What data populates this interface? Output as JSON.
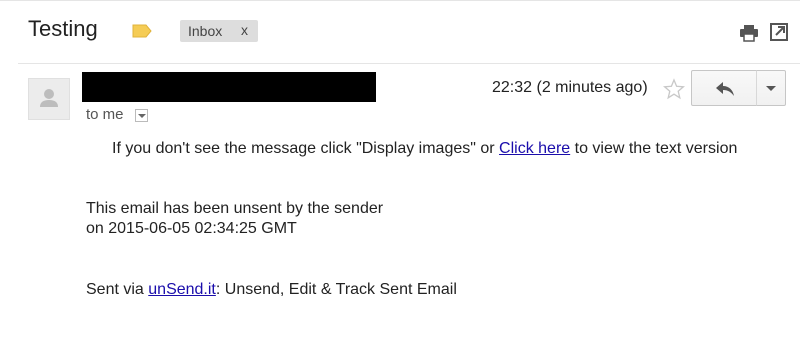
{
  "email": {
    "subject": "Testing",
    "label_chip": {
      "text": "Inbox",
      "close": "x"
    },
    "recipient": "to me",
    "timestamp": "22:32 (2 minutes ago)",
    "body": {
      "notice_before": "If you don't see the message click \"Display images\" or ",
      "notice_link": "Click here",
      "notice_after": " to view the text version",
      "unsent_line1": "This email has been unsent by the sender",
      "unsent_line2": "on 2015-06-05 02:34:25 GMT",
      "sent_via_prefix": "Sent via ",
      "sent_via_link": "unSend.it",
      "sent_via_suffix": ": Unsend, Edit & Track Sent Email"
    }
  },
  "colors": {
    "label_tag": "#f5cc55",
    "chip_bg": "#dddddd",
    "link": "#1a0dab",
    "sender_redaction": "#000000"
  },
  "icons": [
    "label-tag-icon",
    "print-icon",
    "popout-icon",
    "avatar-placeholder-icon",
    "dropdown-arrow-icon",
    "star-icon",
    "reply-icon",
    "chevron-down-icon"
  ]
}
